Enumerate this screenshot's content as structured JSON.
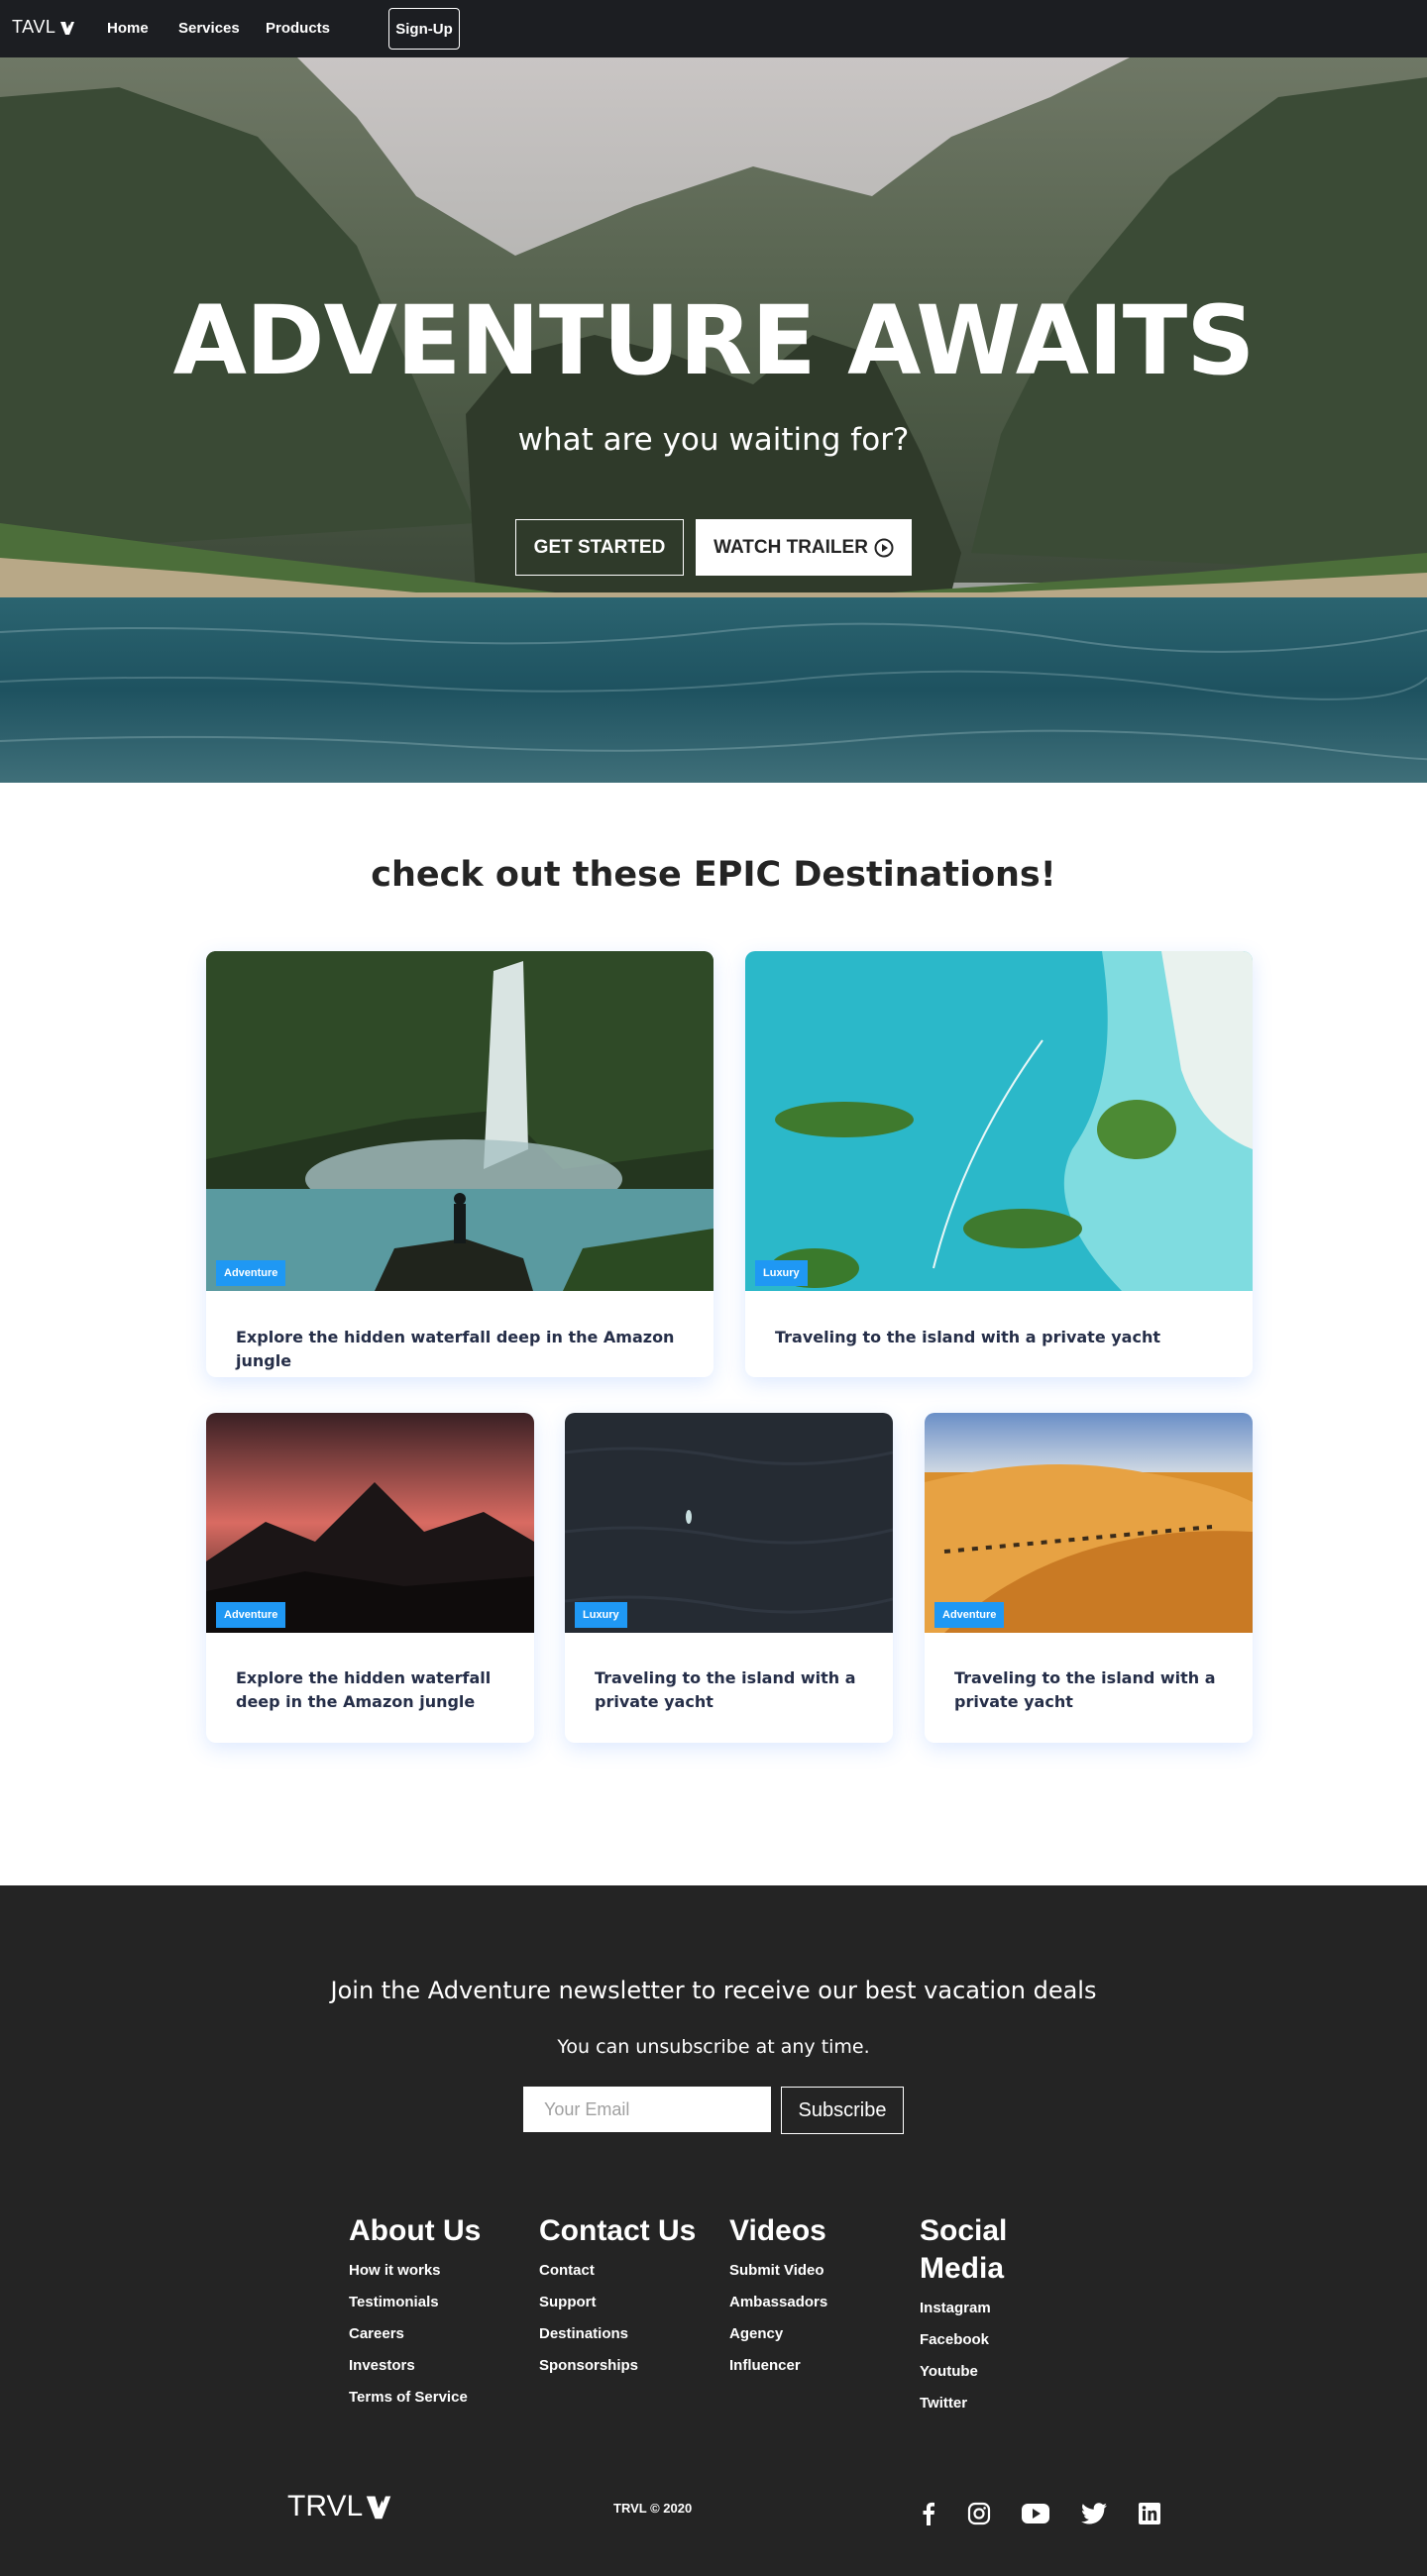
{
  "navbar": {
    "brand": "TAVL",
    "links": [
      "Home",
      "Services",
      "Products"
    ],
    "signup": "Sign-Up"
  },
  "hero": {
    "title": "ADVENTURE AWAITS",
    "subtitle": "what are you waiting for?",
    "get_started": "GET STARTED",
    "watch_trailer": "WATCH TRAILER"
  },
  "destinations": {
    "heading": "check out these EPIC Destinations!",
    "cards": [
      {
        "badge": "Adventure",
        "text": "Explore the hidden waterfall deep in the Amazon jungle"
      },
      {
        "badge": "Luxury",
        "text": "Traveling to the island with a private yacht"
      },
      {
        "badge": "Adventure",
        "text": "Explore the hidden waterfall deep in the Amazon jungle"
      },
      {
        "badge": "Luxury",
        "text": "Traveling to the island with a private yacht"
      },
      {
        "badge": "Adventure",
        "text": "Traveling to the island with a private yacht"
      }
    ]
  },
  "newsletter": {
    "heading": "Join the Adventure newsletter to receive our best vacation deals",
    "subtext": "You can unsubscribe at any time.",
    "email_placeholder": "Your Email",
    "subscribe": "Subscribe"
  },
  "footer": {
    "columns": [
      {
        "title": "About Us",
        "links": [
          "How it works",
          "Testimonials",
          "Careers",
          "Investors",
          "Terms of Service"
        ]
      },
      {
        "title": "Contact Us",
        "links": [
          "Contact",
          "Support",
          "Destinations",
          "Sponsorships"
        ]
      },
      {
        "title": "Videos",
        "links": [
          "Submit Video",
          "Ambassadors",
          "Agency",
          "Influencer"
        ]
      },
      {
        "title": "Social Media",
        "links": [
          "Instagram",
          "Facebook",
          "Youtube",
          "Twitter"
        ]
      }
    ],
    "logo": "TRVL",
    "copyright": "TRVL © 2020",
    "social_icons": [
      "facebook-icon",
      "instagram-icon",
      "youtube-icon",
      "twitter-icon",
      "linkedin-icon"
    ]
  },
  "colors": {
    "navbar_bg": "#1c1e22",
    "footer_bg": "#242424",
    "badge": "#1f98f4",
    "card_text": "#252e48"
  }
}
